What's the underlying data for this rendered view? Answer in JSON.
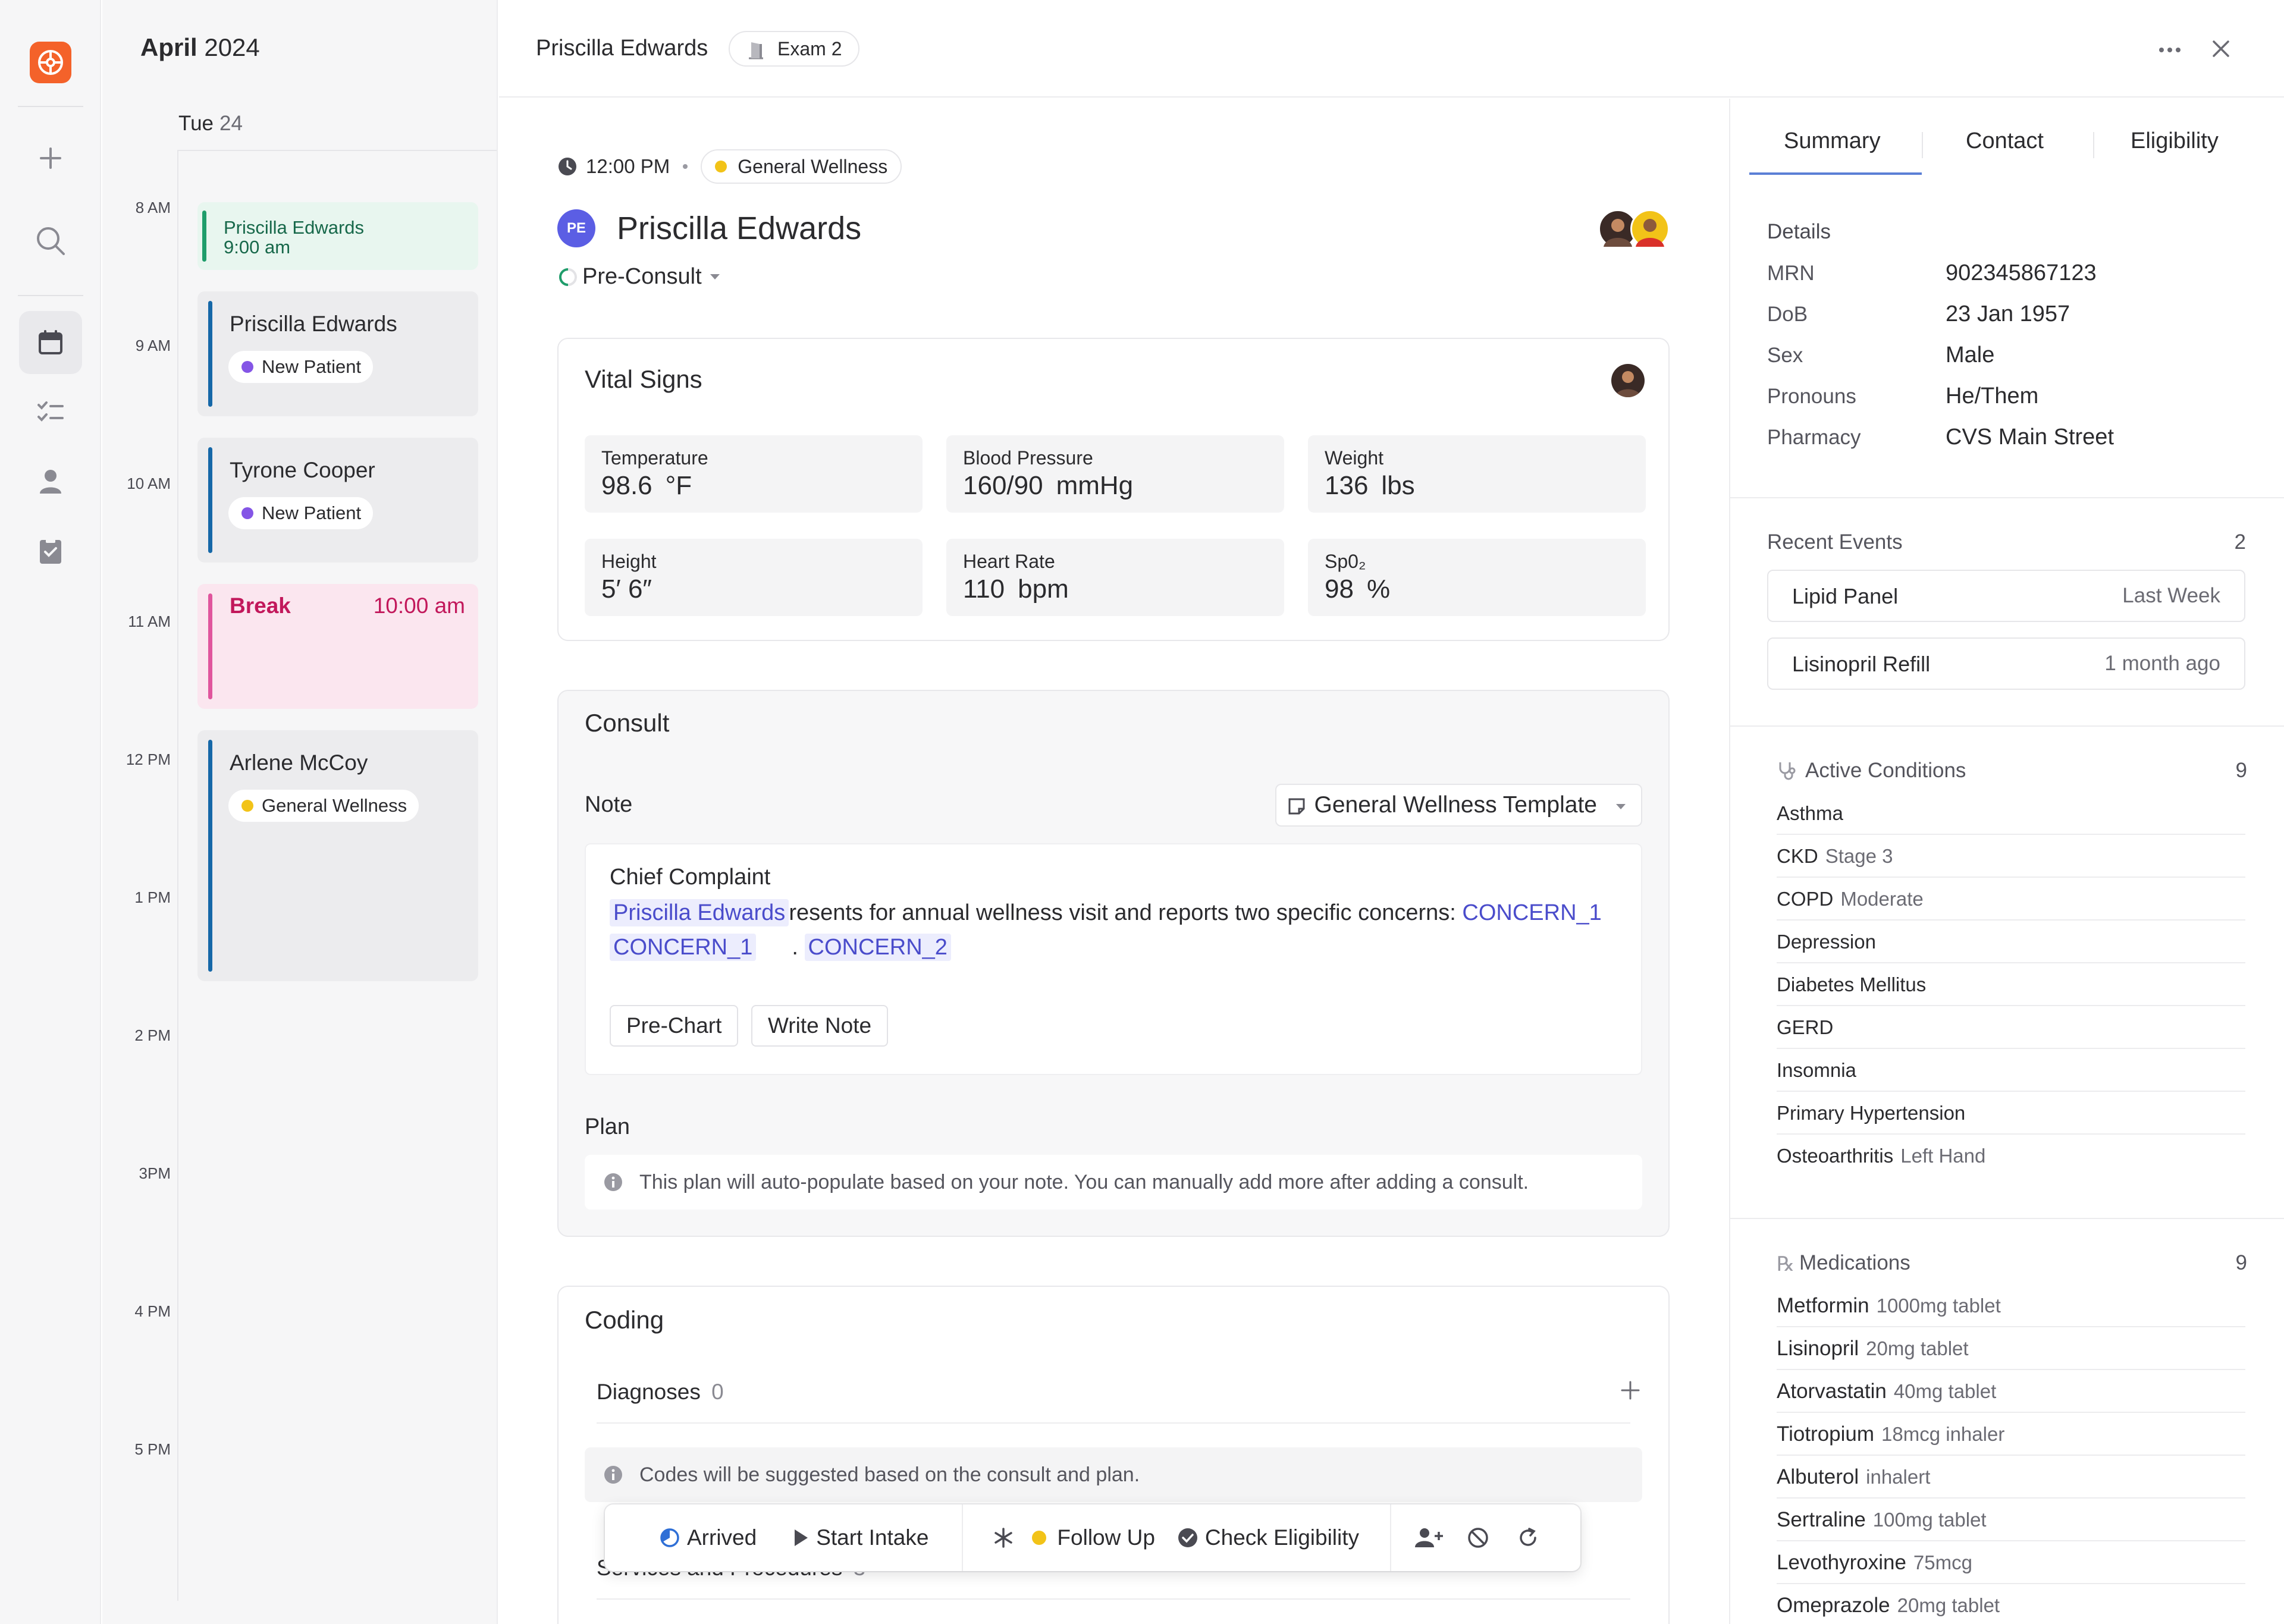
{
  "colors": {
    "brand": "#f4622a",
    "green": "#1f9d6b",
    "blue": "#1668a8",
    "pink": "#e0559d",
    "purple": "#8455e6",
    "yellow": "#f2c318",
    "link": "#4a4ccb"
  },
  "rail": {
    "icons": [
      "logo-icon",
      "plus-icon",
      "search-icon",
      "calendar-icon",
      "checklist-icon",
      "person-icon",
      "clipboard-icon"
    ]
  },
  "calendar": {
    "month": "April",
    "year": "2024",
    "day_name": "Tue",
    "day_num": "24",
    "hours": [
      "8 AM",
      "9 AM",
      "10 AM",
      "11 AM",
      "12 PM",
      "1 PM",
      "2 PM",
      "3PM",
      "4 PM",
      "5 PM"
    ],
    "appointments": [
      {
        "name": "Priscilla Edwards",
        "time": "9:00 am"
      },
      {
        "name": "Priscilla Edwards",
        "badge": "New Patient"
      },
      {
        "name": "Tyrone Cooper",
        "badge": "New Patient"
      },
      {
        "name": "Break",
        "time": "10:00 am"
      },
      {
        "name": "Arlene McCoy",
        "badge": "General Wellness"
      }
    ]
  },
  "topbar": {
    "patient": "Priscilla Edwards",
    "room": "Exam 2"
  },
  "visit": {
    "time": "12:00 PM",
    "type": "General Wellness",
    "initials": "PE",
    "patient": "Priscilla Edwards",
    "status": "Pre-Consult"
  },
  "vitals": {
    "title": "Vital Signs",
    "items": [
      {
        "label": "Temperature",
        "value": "98.6",
        "unit": "°F"
      },
      {
        "label": "Blood Pressure",
        "value": "160/90",
        "unit": "mmHg"
      },
      {
        "label": "Weight",
        "value": "136",
        "unit": "lbs"
      },
      {
        "label": "Height",
        "value": "5′ 6″",
        "unit": ""
      },
      {
        "label": "Heart Rate",
        "value": "110",
        "unit": "bpm"
      },
      {
        "label": "Sp0₂",
        "value": "98",
        "unit": "%"
      }
    ]
  },
  "consult": {
    "title": "Consult",
    "note_label": "Note",
    "template": "General Wellness Template",
    "chief_complaint": "Chief Complaint",
    "patient_chip": "Priscilla Edwards",
    "text": "resents for annual wellness visit and reports two specific concerns:",
    "concern_a": "CONCERN_1",
    "concern_b": "CONCERN_1",
    "concern_c": "CONCERN_2",
    "period": ".",
    "btn_prechart": "Pre-Chart",
    "btn_write": "Write Note",
    "plan_label": "Plan",
    "plan_info": "This plan will auto-populate based on your note. You can manually add more after adding a consult."
  },
  "coding": {
    "title": "Coding",
    "diagnoses": "Diagnoses",
    "diagnoses_count": "0",
    "info": "Codes will be suggested based on the consult and plan.",
    "services": "Services and Procedures",
    "services_count": "3"
  },
  "actions": {
    "arrived": "Arrived",
    "start_intake": "Start Intake",
    "follow_up": "Follow Up",
    "check_eligibility": "Check Eligibility"
  },
  "right": {
    "tabs": [
      "Summary",
      "Contact",
      "Eligibility"
    ],
    "details_title": "Details",
    "details": [
      {
        "k": "MRN",
        "v": "902345867123"
      },
      {
        "k": "DoB",
        "v": "23 Jan 1957"
      },
      {
        "k": "Sex",
        "v": "Male"
      },
      {
        "k": "Pronouns",
        "v": "He/Them"
      },
      {
        "k": "Pharmacy",
        "v": "CVS Main Street"
      }
    ],
    "recent_title": "Recent Events",
    "recent_count": "2",
    "recent": [
      {
        "name": "Lipid Panel",
        "when": "Last Week"
      },
      {
        "name": "Lisinopril Refill",
        "when": "1 month ago"
      }
    ],
    "conditions_title": "Active Conditions",
    "conditions_count": "9",
    "conditions": [
      {
        "name": "Asthma",
        "detail": ""
      },
      {
        "name": "CKD",
        "detail": "Stage 3"
      },
      {
        "name": "COPD",
        "detail": "Moderate"
      },
      {
        "name": "Depression",
        "detail": ""
      },
      {
        "name": "Diabetes Mellitus",
        "detail": ""
      },
      {
        "name": "GERD",
        "detail": ""
      },
      {
        "name": "Insomnia",
        "detail": ""
      },
      {
        "name": "Primary Hypertension",
        "detail": ""
      },
      {
        "name": "Osteoarthritis",
        "detail": "Left Hand"
      }
    ],
    "meds_title": "Medications",
    "meds_count": "9",
    "meds": [
      {
        "name": "Metformin",
        "detail": "1000mg tablet"
      },
      {
        "name": "Lisinopril",
        "detail": "20mg tablet"
      },
      {
        "name": "Atorvastatin",
        "detail": "40mg tablet"
      },
      {
        "name": "Tiotropium",
        "detail": "18mcg inhaler"
      },
      {
        "name": "Albuterol",
        "detail": "inhalert"
      },
      {
        "name": "Sertraline",
        "detail": "100mg tablet"
      },
      {
        "name": "Levothyroxine",
        "detail": "75mcg"
      },
      {
        "name": "Omeprazole",
        "detail": "20mg tablet"
      }
    ]
  }
}
